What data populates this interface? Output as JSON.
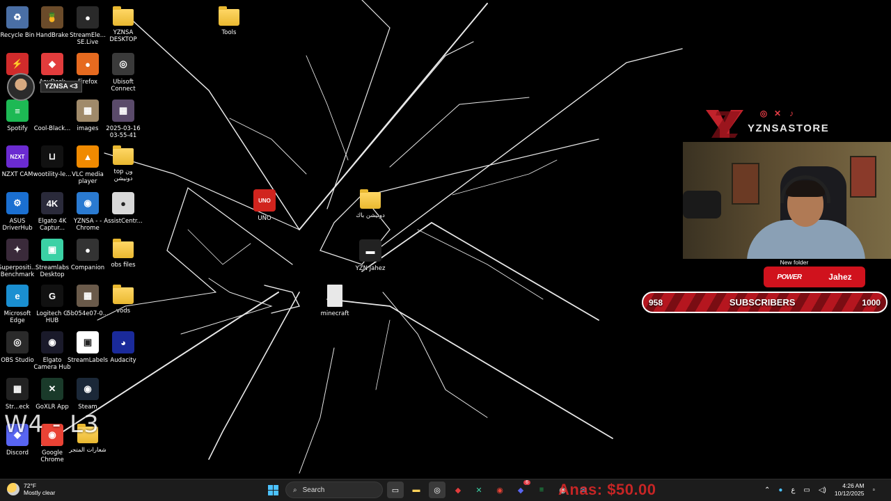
{
  "desktop": {
    "icons": [
      {
        "label": "Recycle Bin",
        "glyph": "♻",
        "color": "#4a6fa5"
      },
      {
        "label": "HandBrake",
        "glyph": "🍍",
        "color": "#6b4b2a"
      },
      {
        "label": "StreamEle...\nSE.Live",
        "glyph": "●",
        "color": "#2a2a2a"
      },
      {
        "label": "YZNSA\nDESKTOP",
        "glyph": "folder",
        "color": "#e9b830"
      },
      {
        "label": "Tools",
        "glyph": "folder",
        "color": "#e9b830"
      },
      {
        "label": "",
        "glyph": "⚡",
        "color": "#d12b2b"
      },
      {
        "label": "AnyDesk",
        "glyph": "◆",
        "color": "#e23c3c"
      },
      {
        "label": "Firefox",
        "glyph": "●",
        "color": "#e66a1f"
      },
      {
        "label": "Ubisoft\nConnect",
        "glyph": "◎",
        "color": "#3a3a3a"
      },
      {
        "label": "Spotify",
        "glyph": "≡",
        "color": "#1db954"
      },
      {
        "label": "Cool-Black...",
        "glyph": "",
        "color": "#000000"
      },
      {
        "label": "images",
        "glyph": "▦",
        "color": "#a08a6a"
      },
      {
        "label": "2025-03-16\n03-55-41",
        "glyph": "▦",
        "color": "#5a4a6a"
      },
      {
        "label": "NZXT CAM",
        "glyph": "NZXT",
        "color": "#6b2bd1"
      },
      {
        "label": "wootility-le...",
        "glyph": "⊔",
        "color": "#111111"
      },
      {
        "label": "VLC media\nplayer",
        "glyph": "▲",
        "color": "#f08a00"
      },
      {
        "label": "top ون\nدونيشن",
        "glyph": "folder",
        "color": "#e9b830"
      },
      {
        "label": "ASUS\nDriverHub",
        "glyph": "⚙",
        "color": "#1a6fd1"
      },
      {
        "label": "Elgato 4K\nCaptur...",
        "glyph": "4K",
        "color": "#2a2a3a"
      },
      {
        "label": "YZNSA - -\nChrome",
        "glyph": "◉",
        "color": "#2a7ad1"
      },
      {
        "label": "AssistCentr...",
        "glyph": "●",
        "color": "#d8d8d8"
      },
      {
        "label": "UNO",
        "glyph": "UNO",
        "color": "#d1241e"
      },
      {
        "label": "دونيشن باك",
        "glyph": "folder",
        "color": "#e9b830"
      },
      {
        "label": "Superpositi...\nBenchmark",
        "glyph": "✦",
        "color": "#3a2a3a"
      },
      {
        "label": "Streamlabs\nDesktop",
        "glyph": "▣",
        "color": "#3bd1a5"
      },
      {
        "label": "Companion",
        "glyph": "●",
        "color": "#333333"
      },
      {
        "label": "obs files",
        "glyph": "folder",
        "color": "#e9b830"
      },
      {
        "label": "YZN Jahez",
        "glyph": "▬",
        "color": "#222222"
      },
      {
        "label": "Microsoft\nEdge",
        "glyph": "e",
        "color": "#1a8fd1"
      },
      {
        "label": "Logitech G\nHUB",
        "glyph": "G",
        "color": "#111111"
      },
      {
        "label": "5b054e07-0...",
        "glyph": "▦",
        "color": "#6a5a4a"
      },
      {
        "label": "vods",
        "glyph": "folder",
        "color": "#e9b830"
      },
      {
        "label": "minecraft",
        "glyph": "doc",
        "color": "#e8e8e8"
      },
      {
        "label": "OBS Studio",
        "glyph": "◎",
        "color": "#2a2a2a"
      },
      {
        "label": "Elgato\nCamera Hub",
        "glyph": "◉",
        "color": "#1a1a2a"
      },
      {
        "label": "StreamLabels",
        "glyph": "▣",
        "color": "#ffffff"
      },
      {
        "label": "Audacity",
        "glyph": "◕",
        "color": "#1a2a9a"
      },
      {
        "label": "Str...eck",
        "glyph": "▦",
        "color": "#222222"
      },
      {
        "label": "GoXLR App",
        "glyph": "✕",
        "color": "#1a3a2a"
      },
      {
        "label": "Steam",
        "glyph": "◉",
        "color": "#1b2838"
      },
      {
        "label": "Discord",
        "glyph": "◆",
        "color": "#5865f2"
      },
      {
        "label": "Google\nChrome",
        "glyph": "◉",
        "color": "#ea4335"
      },
      {
        "label": "شعارات المتجر",
        "glyph": "folder",
        "color": "#e9b830"
      }
    ]
  },
  "overlay": {
    "tooltip": "YZNSA <3",
    "score": "W4 - L3",
    "brand_logo": "YZ",
    "brand_name": "YZNSASTORE",
    "new_folder_label": "New folder",
    "sponsor_1": "POWER",
    "sponsor_2": "Jahez",
    "subs_current": "958",
    "subs_label": "SUBSCRIBERS",
    "subs_goal": "1000",
    "subs_progress": 0.958
  },
  "taskbar": {
    "weather_temp": "72°F",
    "weather_desc": "Mostly clear",
    "search_placeholder": "Search",
    "donation": "Anas: $50.00",
    "ime_indicator": "ع",
    "time": "4:26 AM",
    "date": "10/12/2025",
    "notification_badge": "6",
    "colors": {
      "accent": "#4cc2ff",
      "bar": "#1c1c1c"
    }
  }
}
